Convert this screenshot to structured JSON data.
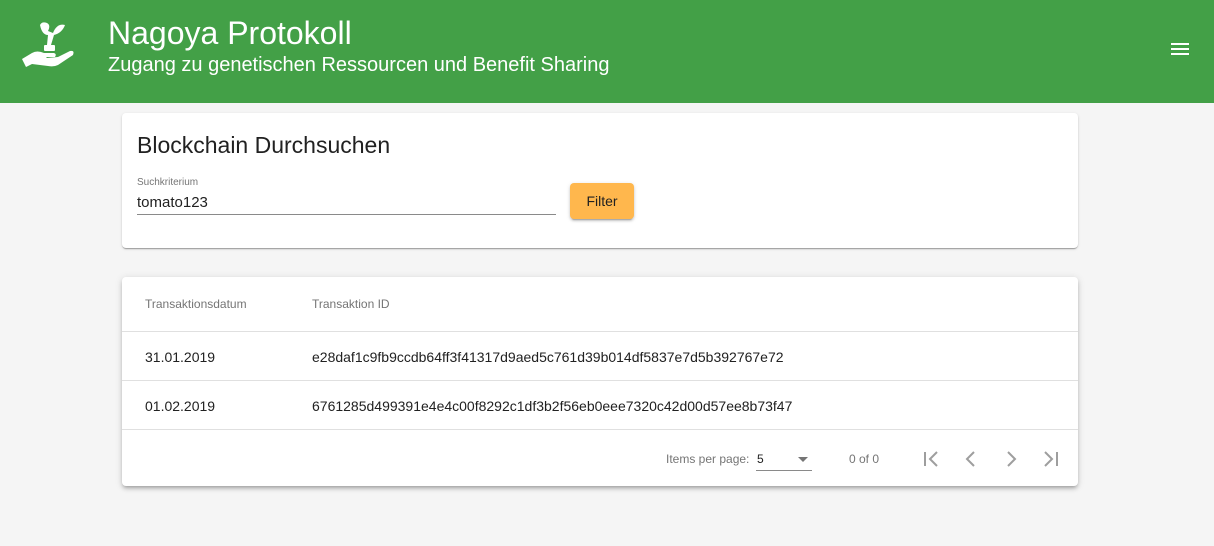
{
  "header": {
    "title": "Nagoya Protokoll",
    "subtitle": "Zugang zu genetischen Ressourcen und Benefit Sharing",
    "logo_icon": "hand-with-plant-icon",
    "menu_icon": "hamburger-menu-icon",
    "bg_color": "#43a047"
  },
  "search": {
    "title": "Blockchain Durchsuchen",
    "field_label": "Suchkriterium",
    "field_value": "tomato123",
    "filter_label": "Filter",
    "filter_color": "#ffb74d"
  },
  "table": {
    "columns": [
      "Transaktionsdatum",
      "Transaktion ID"
    ],
    "rows": [
      {
        "date": "31.01.2019",
        "id": "e28daf1c9fb9ccdb64ff3f41317d9aed5c761d39b014df5837e7d5b392767e72"
      },
      {
        "date": "01.02.2019",
        "id": "6761285d499391e4e4c00f8292c1df3b2f56eb0eee7320c42d00d57ee8b73f47"
      }
    ]
  },
  "paginator": {
    "items_per_page_label": "Items per page:",
    "items_per_page_value": "5",
    "range_label": "0 of 0",
    "icons": [
      "first-page-icon",
      "previous-page-icon",
      "next-page-icon",
      "last-page-icon"
    ]
  }
}
